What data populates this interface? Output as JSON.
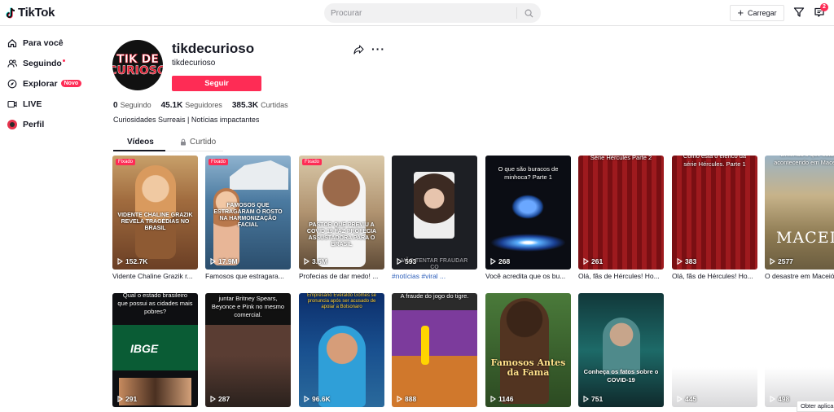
{
  "topbar": {
    "logo_text": "TikTok",
    "search_placeholder": "Procurar",
    "upload_label": "Carregar",
    "inbox_badge": "2"
  },
  "sidebar": {
    "items": [
      {
        "label": "Para você",
        "icon": "home-icon"
      },
      {
        "label": "Seguindo",
        "icon": "people-icon"
      },
      {
        "label": "Explorar",
        "icon": "compass-icon",
        "badge": "Novo"
      },
      {
        "label": "LIVE",
        "icon": "live-icon"
      },
      {
        "label": "Perfil",
        "icon": "profile-icon"
      }
    ]
  },
  "profile": {
    "avatar_line1": "TIK DE",
    "avatar_line2": "CURIOSO",
    "username": "tikdecurioso",
    "nickname": "tikdecurioso",
    "follow_label": "Seguir",
    "following_count": "0",
    "following_label": "Seguindo",
    "followers_count": "45.1K",
    "followers_label": "Seguidores",
    "likes_count": "385.3K",
    "likes_label": "Curtidas",
    "bio": "Curiosidades Surreais | Notícias impactantes"
  },
  "tabs": {
    "videos": "Vídeos",
    "liked": "Curtido"
  },
  "videos_row1": [
    {
      "pinned": "Fixado",
      "overlay": "VIDENTE CHALINE GRAZIK REVELA TRAGÉDIAS NO BRASIL",
      "views": "152.7K",
      "caption": "Vidente Chaline Grazik r..."
    },
    {
      "pinned": "Fixado",
      "overlay": "FAMOSOS QUE ESTRAGARAM O ROSTO NA HARMONIZAÇÃO FACIAL",
      "views": "17.9M",
      "caption": "Famosos que estragara..."
    },
    {
      "pinned": "Fixado",
      "overlay": "PASTOR QUE PREVIU A COVID 19 FAZ PROFECIA ASSUSTADORA PARA O BRASIL",
      "views": "3.5M",
      "caption": "Profecias de dar medo! ..."
    },
    {
      "pinned": "",
      "overlay": "VÃO TENTAR FRAUDAR CO",
      "views": "593",
      "caption": "#notícias #viral ..."
    },
    {
      "pinned": "",
      "overlay": "O que são buracos de minhoca? Parte 1",
      "views": "268",
      "caption": "Você acredita que os bu..."
    },
    {
      "pinned": "",
      "overlay": "Série Hércules Parte 2",
      "views": "261",
      "caption": "Olá, fãs de Hércules! Ho..."
    },
    {
      "pinned": "",
      "overlay": "Como está o elenco da série Hércules. Parte 1",
      "views": "383",
      "caption": "Olá, fãs de Hércules! Ho..."
    },
    {
      "pinned": "",
      "overlay": "Entenda o que está acontecendo em Maceió",
      "title": "MACEIÓ",
      "views": "2577",
      "caption": "O desastre em Maceió"
    }
  ],
  "videos_row2": [
    {
      "overlay": "Qual o estado brasileiro que possui as cidades mais pobres?",
      "brand": "IBGE",
      "views": "291"
    },
    {
      "overlay": "juntar Britney Spears, Beyonce e Pink no mesmo comercial.",
      "views": "287"
    },
    {
      "overlay": "Empresário Everaldo Gomes se pronuncia após ser acusado de apoiar a Bolsonaro",
      "views": "96.6K"
    },
    {
      "overlay": "A fraude do jogo do tigre.",
      "views": "888"
    },
    {
      "overlay": "Famosos Antes da Fama",
      "views": "1146"
    },
    {
      "overlay": "Conheça os fatos sobre o COVID-19",
      "views": "751"
    },
    {
      "overlay": "",
      "views": "445"
    },
    {
      "overlay": "",
      "views": "498"
    }
  ],
  "footer": {
    "get_app": "Obter aplica"
  }
}
